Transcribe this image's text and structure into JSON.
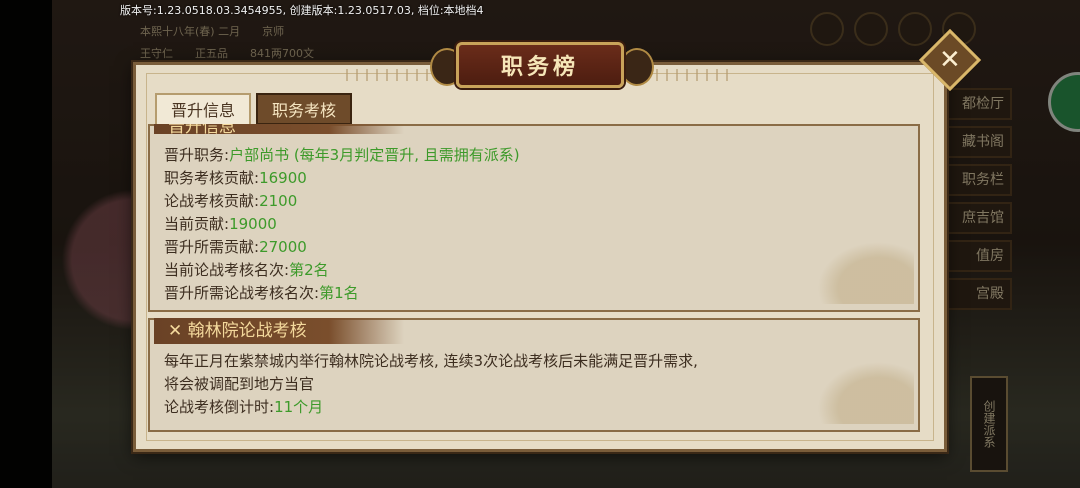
{
  "version_text": "版本号:1.23.0518.03.3454955, 创建版本:1.23.0517.03, 档位:本地档4",
  "top_info": {
    "row1": [
      "本熙十八年(春) 二月",
      "京师"
    ],
    "row2": [
      "王守仁",
      "正五品",
      "841两700文"
    ]
  },
  "title": "职务榜",
  "close_symbol": "✕",
  "tabs": [
    {
      "label": "晋升信息"
    },
    {
      "label": "职务考核"
    }
  ],
  "promotion": {
    "header": "晋升信息",
    "lines": [
      {
        "label": "晋升职务:",
        "value": "户部尚书 (每年3月判定晋升, 且需拥有派系)"
      },
      {
        "label": "职务考核贡献:",
        "value": "16900"
      },
      {
        "label": "论战考核贡献:",
        "value": "2100"
      },
      {
        "label": "当前贡献:",
        "value": "19000"
      },
      {
        "label": "晋升所需贡献:",
        "value": "27000"
      },
      {
        "label": "当前论战考核名次:",
        "value": "第2名"
      },
      {
        "label": "晋升所需论战考核名次:",
        "value": "第1名"
      }
    ]
  },
  "hanlin": {
    "header": "翰林院论战考核",
    "desc1": "每年正月在紫禁城内举行翰林院论战考核, 连续3次论战考核后未能满足晋升需求,",
    "desc2": "将会被调配到地方当官",
    "countdown_label": "论战考核倒计时:",
    "countdown_value": "11个月"
  },
  "right_buttons": [
    "都检厅",
    "藏书阁",
    "职务栏",
    "庶吉馆",
    "值房",
    "宫殿"
  ],
  "create_button": "创建派系",
  "colors": {
    "accent_green": "#3d9a2a",
    "panel_bg": "#e6dcc6",
    "tab_active": "#6e4b2a"
  }
}
